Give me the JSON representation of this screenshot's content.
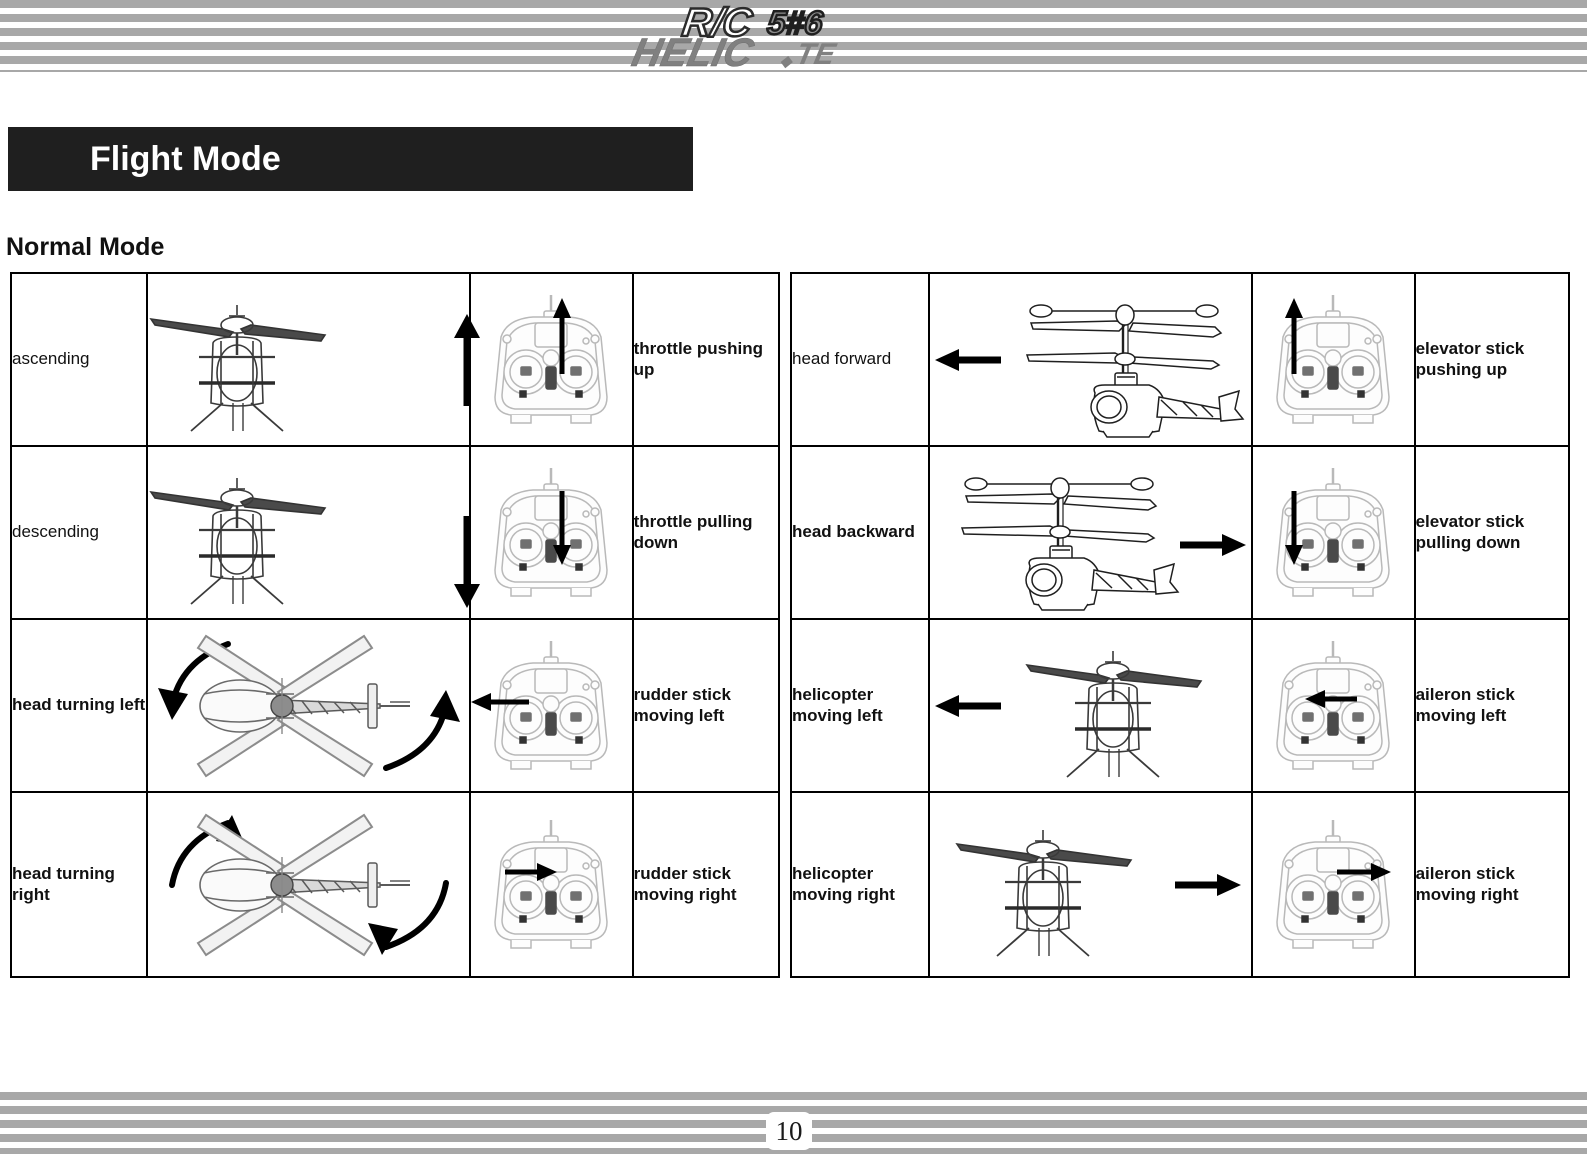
{
  "header": {
    "logo_line1": "R/C",
    "logo_line2": "HELICOPTER",
    "logo_badge": "5#6",
    "logo_sub": "TE"
  },
  "title_bar": {
    "title": "Flight Mode"
  },
  "section": {
    "heading": "Normal Mode"
  },
  "footer": {
    "page_number": "10"
  },
  "left_table": {
    "rows": [
      {
        "action": "ascending",
        "action_bold": false,
        "heli_icon": "helicopter-front-view",
        "heli_arrow": "arrow-up",
        "tx_icon": "transmitter-front",
        "tx_arrow": "arrow-up-right-stick",
        "stick": "throttle pushing up"
      },
      {
        "action": "descending",
        "action_bold": false,
        "heli_icon": "helicopter-front-view",
        "heli_arrow": "arrow-down",
        "tx_icon": "transmitter-front",
        "tx_arrow": "arrow-down-right-stick",
        "stick": "throttle pulling down"
      },
      {
        "action": "head turning left",
        "action_bold": true,
        "heli_icon": "helicopter-top-view",
        "heli_arrow": "rotate-counterclockwise",
        "tx_icon": "transmitter-front",
        "tx_arrow": "arrow-left-left-stick",
        "stick": "rudder stick moving left"
      },
      {
        "action": "head turning right",
        "action_bold": true,
        "heli_icon": "helicopter-top-view",
        "heli_arrow": "rotate-clockwise",
        "tx_icon": "transmitter-front",
        "tx_arrow": "arrow-right-left-stick",
        "stick": "rudder stick moving right"
      }
    ]
  },
  "right_table": {
    "rows": [
      {
        "action": "head forward",
        "action_bold": false,
        "heli_icon": "helicopter-side-view",
        "heli_arrow": "arrow-left",
        "tx_icon": "transmitter-front",
        "tx_arrow": "arrow-up-left-stick",
        "stick": "elevator stick pushing up"
      },
      {
        "action": "head backward",
        "action_bold": true,
        "heli_icon": "helicopter-side-view",
        "heli_arrow": "arrow-right",
        "tx_icon": "transmitter-front",
        "tx_arrow": "arrow-down-left-stick",
        "stick": "elevator stick pulling down"
      },
      {
        "action": "helicopter moving left",
        "action_bold": true,
        "heli_icon": "helicopter-front-view",
        "heli_arrow": "arrow-left",
        "tx_icon": "transmitter-front",
        "tx_arrow": "arrow-left-right-stick",
        "stick": "aileron stick moving left"
      },
      {
        "action": "helicopter moving right",
        "action_bold": true,
        "heli_icon": "helicopter-front-view",
        "heli_arrow": "arrow-right",
        "tx_icon": "transmitter-front",
        "tx_arrow": "arrow-right-right-stick",
        "stick": "aileron stick moving right"
      }
    ]
  },
  "colors": {
    "stripe": "#a8a8a8",
    "title_bar_bg": "#1f1f1f",
    "title_bar_fg": "#ffffff",
    "table_border": "#000000",
    "text": "#111111"
  }
}
